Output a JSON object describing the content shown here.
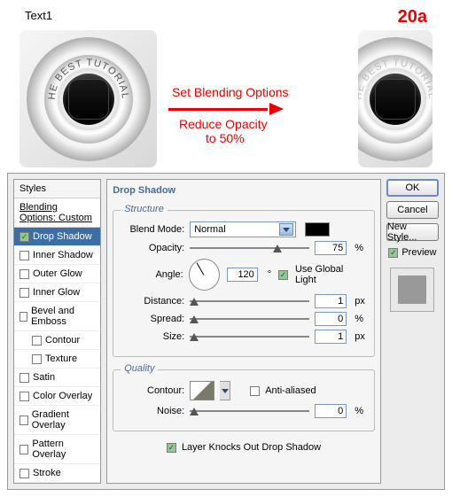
{
  "top": {
    "label": "Text1",
    "step": "20a",
    "arc_text": "THE BEST TUTORIALS",
    "annotation1": "Set Blending Options",
    "annotation2": "Reduce Opacity",
    "annotation3": "to 50%"
  },
  "sidebar": {
    "header": "Styles",
    "sub": "Blending Options: Custom",
    "items": [
      {
        "label": "Drop Shadow",
        "checked": true,
        "active": true
      },
      {
        "label": "Inner Shadow",
        "checked": false
      },
      {
        "label": "Outer Glow",
        "checked": false
      },
      {
        "label": "Inner Glow",
        "checked": false
      },
      {
        "label": "Bevel and Emboss",
        "checked": false
      },
      {
        "label": "Contour",
        "checked": false,
        "indent": true
      },
      {
        "label": "Texture",
        "checked": false,
        "indent": true
      },
      {
        "label": "Satin",
        "checked": false
      },
      {
        "label": "Color Overlay",
        "checked": false
      },
      {
        "label": "Gradient Overlay",
        "checked": false
      },
      {
        "label": "Pattern Overlay",
        "checked": false
      },
      {
        "label": "Stroke",
        "checked": false
      }
    ]
  },
  "panel": {
    "title": "Drop Shadow",
    "structure": {
      "group_label": "Structure",
      "blend_mode": {
        "label": "Blend Mode:",
        "value": "Normal"
      },
      "opacity": {
        "label": "Opacity:",
        "value": "75",
        "unit": "%",
        "pos": 72
      },
      "angle": {
        "label": "Angle:",
        "value": "120",
        "unit": "°",
        "global_label": "Use Global Light",
        "global": true
      },
      "distance": {
        "label": "Distance:",
        "value": "1",
        "unit": "px",
        "pos": 1
      },
      "spread": {
        "label": "Spread:",
        "value": "0",
        "unit": "%",
        "pos": 0
      },
      "size": {
        "label": "Size:",
        "value": "1",
        "unit": "px",
        "pos": 1
      }
    },
    "quality": {
      "group_label": "Quality",
      "contour": {
        "label": "Contour:",
        "aa_label": "Anti-aliased",
        "aa": false
      },
      "noise": {
        "label": "Noise:",
        "value": "0",
        "unit": "%",
        "pos": 0
      }
    },
    "knockout": {
      "label": "Layer Knocks Out Drop Shadow",
      "checked": true
    }
  },
  "buttons": {
    "ok": "OK",
    "cancel": "Cancel",
    "newstyle": "New Style...",
    "preview": "Preview"
  }
}
